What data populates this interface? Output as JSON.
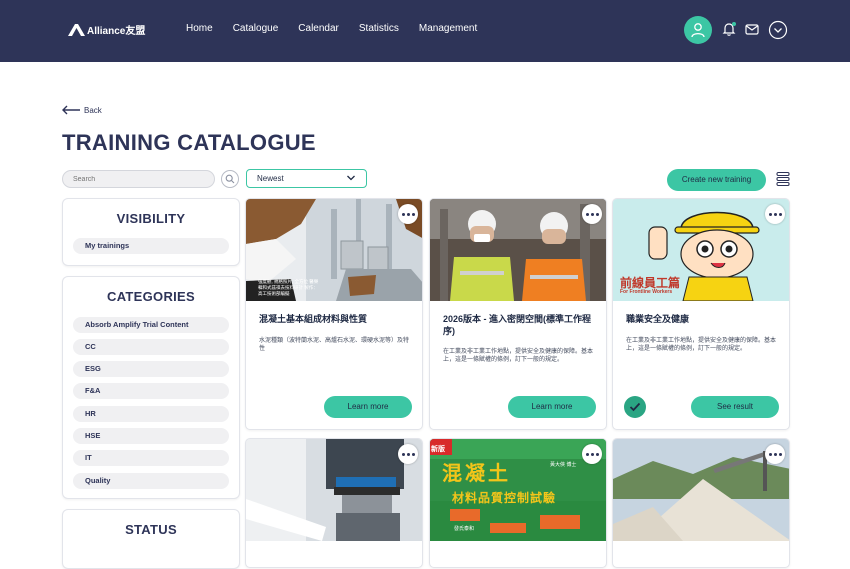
{
  "header": {
    "logo_text": "Alliance友盟",
    "nav": [
      "Home",
      "Catalogue",
      "Calendar",
      "Statistics",
      "Management"
    ]
  },
  "back_label": "Back",
  "page_title": "TRAINING CATALOGUE",
  "search": {
    "placeholder": "Search"
  },
  "sort": {
    "selected": "Newest"
  },
  "create_button": "Create new training",
  "sidebar": {
    "visibility": {
      "title": "VISIBILITY",
      "items": [
        "My trainings"
      ]
    },
    "categories": {
      "title": "CATEGORIES",
      "items": [
        "Absorb Amplify Trial Content",
        "CC",
        "ESG",
        "F&A",
        "HR",
        "HSE",
        "IT",
        "Quality"
      ]
    },
    "status": {
      "title": "STATUS"
    }
  },
  "cards": [
    {
      "title": "混凝土基本組成材料與性質",
      "desc": "水泥種類（波特蘭水泥、高爐石水泥、環硬水泥等）及特性",
      "button": "Learn more",
      "image_caption": "強度觀, 規格照片, 全方位 醫樂輯和式茲祺去技料研計 製作：高工技術部編擬"
    },
    {
      "title": "2026版本 - 進入密閉空間(標準工作程序)",
      "desc": "在工業及非工業工作地點，提供安全及健康的保障。基本上，這是一條賦權的條例，訂下一般的規定。",
      "button": "Learn more"
    },
    {
      "title": "職業安全及健康",
      "desc": "在工業及非工業工作地點，提供安全及健康的保障。基本上，這是一條賦權的條例，訂下一般的規定。",
      "button": "See result",
      "image_text": "前線員工篇",
      "image_subtext": "For Frontline Workers",
      "completed": true
    },
    {
      "title": "",
      "desc": "",
      "button": ""
    },
    {
      "title": "",
      "desc": "",
      "button": "",
      "image_text": "混凝土",
      "image_subtext": "材料品質控制試驗",
      "image_tags": [
        "新版",
        "黃大俠 博士",
        "發氏泰和"
      ]
    },
    {
      "title": "",
      "desc": "",
      "button": ""
    }
  ],
  "colors": {
    "header_bg": "#2e3458",
    "accent": "#3cc6a4",
    "check": "#2aa583"
  }
}
